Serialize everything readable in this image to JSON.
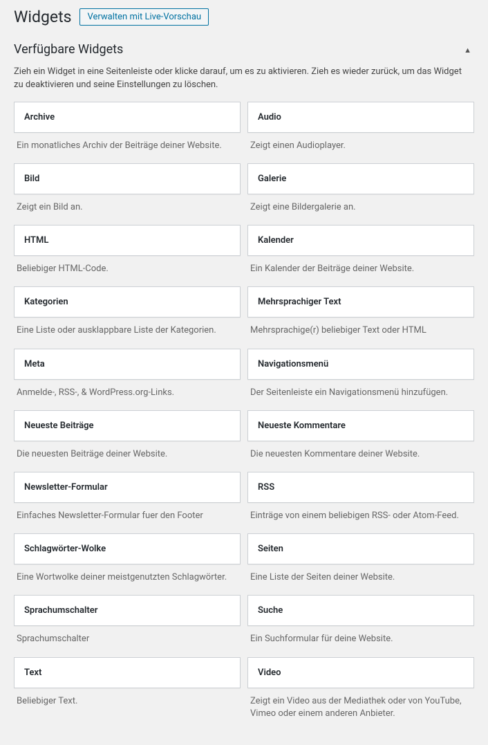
{
  "header": {
    "title": "Widgets",
    "action_label": "Verwalten mit Live-Vorschau"
  },
  "section": {
    "title": "Verfügbare Widgets",
    "description": "Zieh ein Widget in eine Seitenleiste oder klicke darauf, um es zu aktivieren. Zieh es wieder zurück, um das Widget zu deaktivieren und seine Einstellungen zu löschen."
  },
  "widgets": {
    "left": [
      {
        "title": "Archive",
        "desc": "Ein monatliches Archiv der Beiträge deiner Website."
      },
      {
        "title": "Bild",
        "desc": "Zeigt ein Bild an."
      },
      {
        "title": "HTML",
        "desc": "Beliebiger HTML-Code."
      },
      {
        "title": "Kategorien",
        "desc": "Eine Liste oder ausklappbare Liste der Kategorien."
      },
      {
        "title": "Meta",
        "desc": "Anmelde-, RSS-, & WordPress.org-Links."
      },
      {
        "title": "Neueste Beiträge",
        "desc": "Die neuesten Beiträge deiner Website."
      },
      {
        "title": "Newsletter-Formular",
        "desc": "Einfaches Newsletter-Formular fuer den Footer"
      },
      {
        "title": "Schlagwörter-Wolke",
        "desc": "Eine Wortwolke deiner meistgenutzten Schlagwörter."
      },
      {
        "title": "Sprachumschalter",
        "desc": "Sprachumschalter"
      },
      {
        "title": "Text",
        "desc": "Beliebiger Text."
      }
    ],
    "right": [
      {
        "title": "Audio",
        "desc": "Zeigt einen Audioplayer."
      },
      {
        "title": "Galerie",
        "desc": "Zeigt eine Bildergalerie an."
      },
      {
        "title": "Kalender",
        "desc": "Ein Kalender der Beiträge deiner Website."
      },
      {
        "title": "Mehrsprachiger Text",
        "desc": "Mehrsprachige(r) beliebiger Text oder HTML"
      },
      {
        "title": "Navigationsmenü",
        "desc": "Der Seitenleiste ein Navigationsmenü hinzufügen."
      },
      {
        "title": "Neueste Kommentare",
        "desc": "Die neuesten Kommentare deiner Website."
      },
      {
        "title": "RSS",
        "desc": "Einträge von einem beliebigen RSS- oder Atom-Feed."
      },
      {
        "title": "Seiten",
        "desc": "Eine Liste der Seiten deiner Website."
      },
      {
        "title": "Suche",
        "desc": "Ein Suchformular für deine Website."
      },
      {
        "title": "Video",
        "desc": "Zeigt ein Video aus der Mediathek oder von YouTube, Vimeo oder einem anderen Anbieter."
      }
    ]
  }
}
